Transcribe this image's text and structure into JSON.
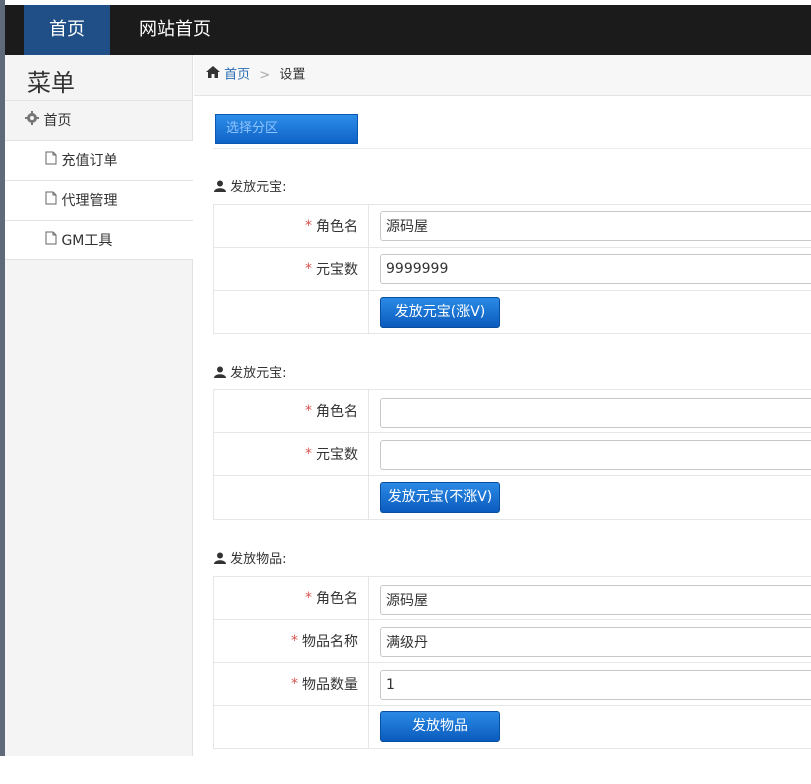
{
  "topnav": {
    "items": [
      {
        "label": "首页",
        "active": true
      },
      {
        "label": "网站首页",
        "active": false
      }
    ]
  },
  "sidebar": {
    "title": "菜单",
    "home_label": "首页",
    "items": [
      {
        "label": "充值订单"
      },
      {
        "label": "代理管理"
      },
      {
        "label": "GM工具"
      }
    ]
  },
  "breadcrumb": {
    "home": "首页",
    "current": "设置"
  },
  "server_select": {
    "label": "选择分区"
  },
  "sections": [
    {
      "title": "发放元宝:",
      "fields": [
        {
          "label": "角色名",
          "value": "源码屋"
        },
        {
          "label": "元宝数",
          "value": "9999999"
        }
      ],
      "button": "发放元宝(涨V)"
    },
    {
      "title": "发放元宝:",
      "fields": [
        {
          "label": "角色名",
          "value": ""
        },
        {
          "label": "元宝数",
          "value": ""
        }
      ],
      "button": "发放元宝(不涨V)"
    },
    {
      "title": "发放物品:",
      "fields": [
        {
          "label": "角色名",
          "value": "源码屋"
        },
        {
          "label": "物品名称",
          "value": "满级丹"
        },
        {
          "label": "物品数量",
          "value": "1"
        }
      ],
      "button": "发放物品"
    }
  ],
  "required_mark": "*",
  "colors": {
    "topbar": "#1b1b1b",
    "active_nav": "#1f4f86",
    "button": "#0a5bbd",
    "link": "#2c6db5",
    "required": "#d9534f"
  }
}
